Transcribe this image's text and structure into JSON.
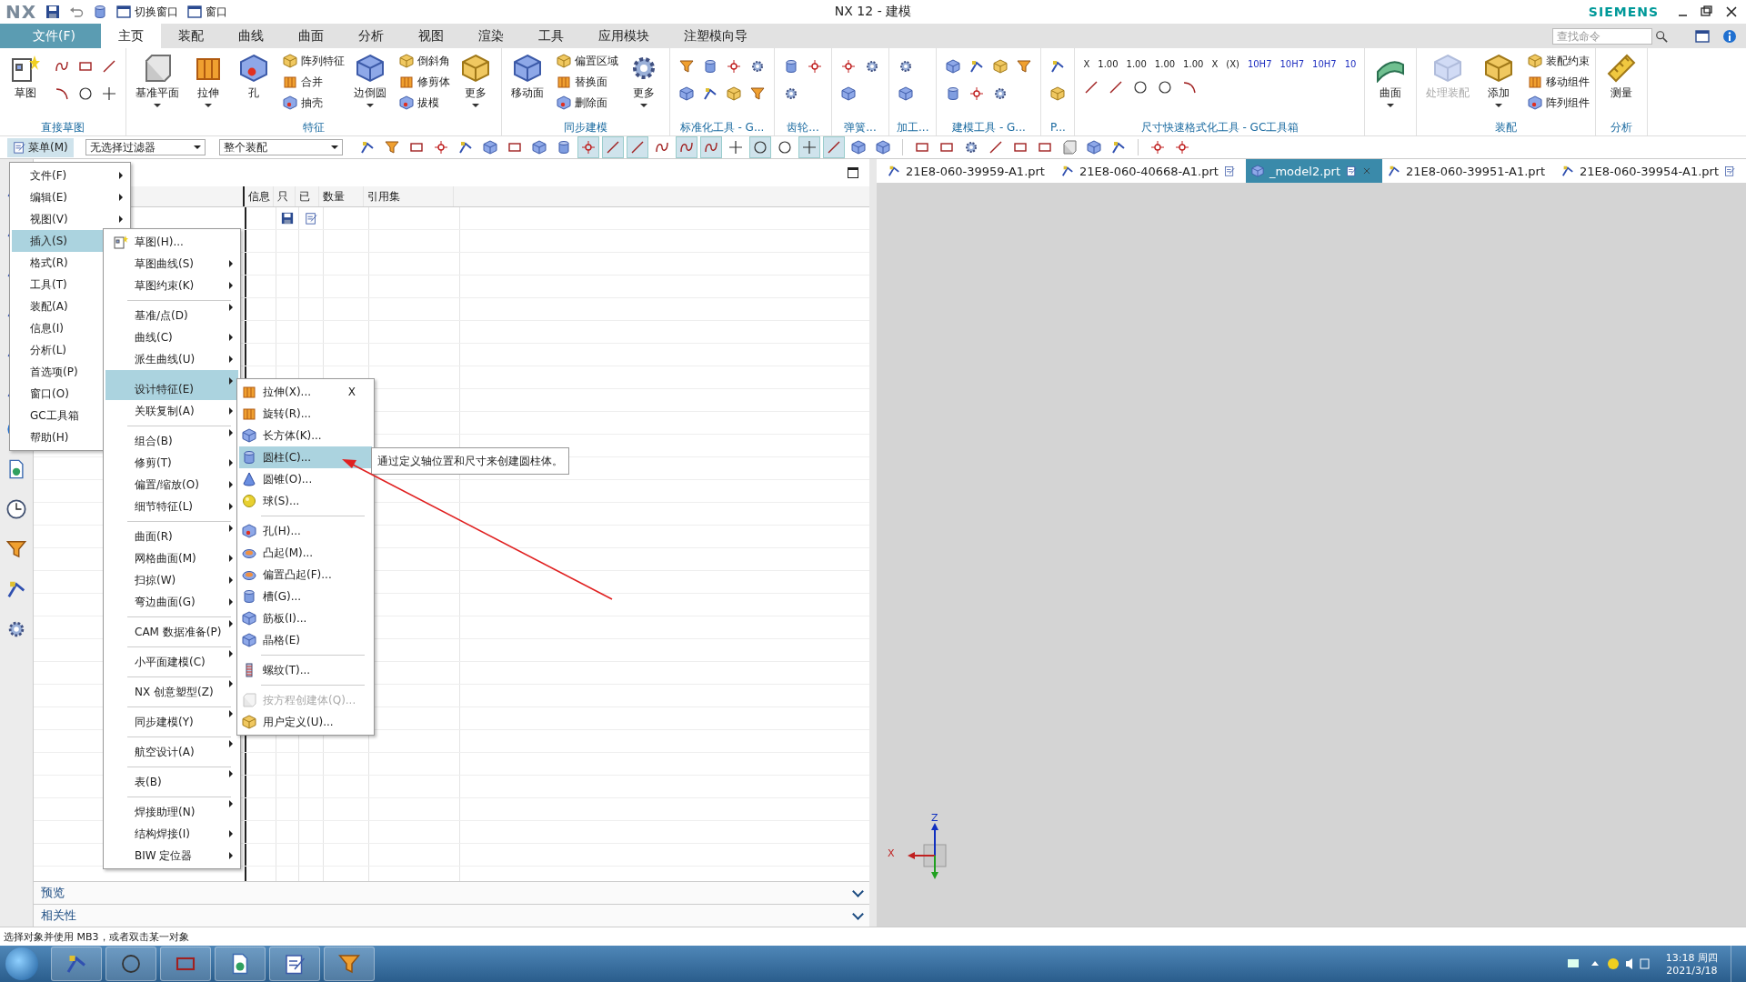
{
  "title_bar": {
    "app_logo": "NX",
    "quick_access": [
      {
        "label": "切换窗口"
      },
      {
        "label": "窗口"
      }
    ],
    "title": "NX 12 - 建模",
    "brand": "SIEMENS"
  },
  "ribbon_tabs": [
    {
      "label": "文件(F)",
      "kind": "file",
      "selected": false
    },
    {
      "label": "主页",
      "kind": "tab",
      "selected": true
    },
    {
      "label": "装配",
      "kind": "tab",
      "selected": false
    },
    {
      "label": "曲线",
      "kind": "tab",
      "selected": false
    },
    {
      "label": "曲面",
      "kind": "tab",
      "selected": false
    },
    {
      "label": "分析",
      "kind": "tab",
      "selected": false
    },
    {
      "label": "视图",
      "kind": "tab",
      "selected": false
    },
    {
      "label": "渲染",
      "kind": "tab",
      "selected": false
    },
    {
      "label": "工具",
      "kind": "tab",
      "selected": false
    },
    {
      "label": "应用模块",
      "kind": "tab",
      "selected": false
    },
    {
      "label": "注塑模向导",
      "kind": "tab",
      "selected": false
    }
  ],
  "search": {
    "placeholder": "查找命令"
  },
  "ribbon_groups": [
    {
      "label": "直接草图",
      "items": [
        {
          "kind": "large",
          "label": "草图",
          "dropdown": false,
          "disabled": false
        },
        {
          "kind": "grid"
        }
      ]
    },
    {
      "label": "特征",
      "items": [
        {
          "kind": "large",
          "label": "基准平面",
          "dropdown": true,
          "disabled": false
        },
        {
          "kind": "large",
          "label": "拉伸",
          "dropdown": true,
          "disabled": false
        },
        {
          "kind": "large",
          "label": "孔",
          "dropdown": false,
          "disabled": false
        },
        {
          "kind": "stack",
          "entries": [
            "阵列特征",
            "合并",
            "抽壳"
          ]
        },
        {
          "kind": "large",
          "label": "边倒圆",
          "dropdown": true,
          "disabled": false
        },
        {
          "kind": "stack",
          "entries": [
            "倒斜角",
            "修剪体",
            "拔模"
          ]
        },
        {
          "kind": "large",
          "label": "更多",
          "dropdown": true,
          "disabled": false
        }
      ]
    },
    {
      "label": "同步建模",
      "items": [
        {
          "kind": "large",
          "label": "移动面",
          "dropdown": false,
          "disabled": false
        },
        {
          "kind": "stack",
          "entries": [
            "偏置区域",
            "替换面",
            "删除面"
          ]
        },
        {
          "kind": "large",
          "label": "更多",
          "dropdown": true,
          "disabled": false
        }
      ]
    },
    {
      "label": "标准化工具 - G...",
      "items": [
        {
          "kind": "grid"
        }
      ]
    },
    {
      "label": "齿轮...",
      "items": [
        {
          "kind": "grid"
        }
      ]
    },
    {
      "label": "弹簧...",
      "items": [
        {
          "kind": "grid"
        }
      ]
    },
    {
      "label": "加工...",
      "items": [
        {
          "kind": "grid"
        }
      ]
    },
    {
      "label": "建模工具 - G...",
      "items": [
        {
          "kind": "grid"
        }
      ]
    },
    {
      "label": "P...",
      "items": [
        {
          "kind": "grid"
        }
      ]
    },
    {
      "label": "尺寸快速格式化工具 - GC工具箱",
      "items": [
        {
          "kind": "format",
          "entries": [
            "X",
            "1.00",
            "1.00",
            "1.00",
            "1.00",
            "X",
            "(X)",
            "10H7",
            "10H7",
            "10H7",
            "10"
          ]
        }
      ]
    },
    {
      "items": [
        {
          "kind": "large",
          "label": "曲面",
          "dropdown": true,
          "disabled": false
        }
      ]
    },
    {
      "label": "装配",
      "items": [
        {
          "kind": "large",
          "label": "处理装配",
          "dropdown": false,
          "disabled": true
        },
        {
          "kind": "large",
          "label": "添加",
          "dropdown": true,
          "disabled": false
        },
        {
          "kind": "stack",
          "entries": [
            "装配约束",
            "移动组件",
            "阵列组件"
          ]
        }
      ]
    },
    {
      "label": "分析",
      "items": [
        {
          "kind": "large",
          "label": "测量",
          "dropdown": false,
          "disabled": false
        }
      ]
    }
  ],
  "toolbar": {
    "menu_button": "菜单(M)",
    "filters": [
      {
        "value": "无选择过滤器"
      },
      {
        "value": "整个装配"
      }
    ],
    "snap_buttons": [
      {
        "on": true
      },
      {
        "on": true
      },
      {
        "on": true
      },
      {
        "on": false
      },
      {
        "on": true
      },
      {
        "on": true
      },
      {
        "on": false
      },
      {
        "on": true
      },
      {
        "on": false
      },
      {
        "on": true
      },
      {
        "on": true
      },
      {
        "on": false
      },
      {
        "on": false
      }
    ]
  },
  "navigator": {
    "columns": [
      "信息",
      "只",
      "已",
      "数量",
      "引用集"
    ],
    "sections": [
      {
        "label": "预览",
        "expanded": false
      },
      {
        "label": "相关性",
        "expanded": false
      }
    ]
  },
  "main_menu": [
    {
      "label": "文件(F)",
      "selected": false
    },
    {
      "label": "编辑(E)",
      "selected": false
    },
    {
      "label": "视图(V)",
      "selected": false
    },
    {
      "label": "插入(S)",
      "selected": true
    },
    {
      "label": "格式(R)",
      "selected": false
    },
    {
      "label": "工具(T)",
      "selected": false
    },
    {
      "label": "装配(A)",
      "selected": false
    },
    {
      "label": "信息(I)",
      "selected": false
    },
    {
      "label": "分析(L)",
      "selected": false
    },
    {
      "label": "首选项(P)",
      "selected": false
    },
    {
      "label": "窗口(O)",
      "selected": false
    },
    {
      "label": "GC工具箱",
      "selected": false
    },
    {
      "label": "帮助(H)",
      "selected": false
    }
  ],
  "insert_menu": [
    {
      "label": "草图(H)...",
      "submenu": false,
      "separator_before": false,
      "selected": false
    },
    {
      "label": "草图曲线(S)",
      "submenu": true,
      "separator_before": false,
      "selected": false
    },
    {
      "label": "草图约束(K)",
      "submenu": true,
      "separator_before": false,
      "selected": false
    },
    {
      "label": "基准/点(D)",
      "submenu": true,
      "separator_before": true,
      "selected": false
    },
    {
      "label": "曲线(C)",
      "submenu": true,
      "separator_before": false,
      "selected": false
    },
    {
      "label": "派生曲线(U)",
      "submenu": true,
      "separator_before": false,
      "selected": false
    },
    {
      "label": "设计特征(E)",
      "submenu": true,
      "separator_before": true,
      "selected": true
    },
    {
      "label": "关联复制(A)",
      "submenu": true,
      "separator_before": false,
      "selected": false
    },
    {
      "label": "组合(B)",
      "submenu": true,
      "separator_before": true,
      "selected": false
    },
    {
      "label": "修剪(T)",
      "submenu": true,
      "separator_before": false,
      "selected": false
    },
    {
      "label": "偏置/缩放(O)",
      "submenu": true,
      "separator_before": false,
      "selected": false
    },
    {
      "label": "细节特征(L)",
      "submenu": true,
      "separator_before": false,
      "selected": false
    },
    {
      "label": "曲面(R)",
      "submenu": true,
      "separator_before": true,
      "selected": false
    },
    {
      "label": "网格曲面(M)",
      "submenu": true,
      "separator_before": false,
      "selected": false
    },
    {
      "label": "扫掠(W)",
      "submenu": true,
      "separator_before": false,
      "selected": false
    },
    {
      "label": "弯边曲面(G)",
      "submenu": true,
      "separator_before": false,
      "selected": false
    },
    {
      "label": "CAM 数据准备(P)",
      "submenu": true,
      "separator_before": true,
      "selected": false
    },
    {
      "label": "小平面建模(C)",
      "submenu": true,
      "separator_before": true,
      "selected": false
    },
    {
      "label": "NX 创意塑型(Z)",
      "submenu": true,
      "separator_before": true,
      "selected": false
    },
    {
      "label": "同步建模(Y)",
      "submenu": true,
      "separator_before": true,
      "selected": false
    },
    {
      "label": "航空设计(A)",
      "submenu": true,
      "separator_before": true,
      "selected": false
    },
    {
      "label": "表(B)",
      "submenu": true,
      "separator_before": true,
      "selected": false
    },
    {
      "label": "焊接助理(N)",
      "submenu": true,
      "separator_before": true,
      "selected": false
    },
    {
      "label": "结构焊接(I)",
      "submenu": true,
      "separator_before": false,
      "selected": false
    },
    {
      "label": "BIW 定位器",
      "submenu": true,
      "separator_before": false,
      "selected": false
    }
  ],
  "feature_menu": [
    {
      "label": "拉伸(X)...",
      "shortcut": "X",
      "separator_before": false,
      "selected": false,
      "disabled": false
    },
    {
      "label": "旋转(R)...",
      "separator_before": false,
      "selected": false,
      "disabled": false
    },
    {
      "label": "长方体(K)...",
      "separator_before": false,
      "selected": false,
      "disabled": false
    },
    {
      "label": "圆柱(C)...",
      "separator_before": false,
      "selected": true,
      "disabled": false
    },
    {
      "label": "圆锥(O)...",
      "separator_before": false,
      "selected": false,
      "disabled": false
    },
    {
      "label": "球(S)...",
      "separator_before": false,
      "selected": false,
      "disabled": false
    },
    {
      "label": "孔(H)...",
      "separator_before": true,
      "selected": false,
      "disabled": false
    },
    {
      "label": "凸起(M)...",
      "separator_before": false,
      "selected": false,
      "disabled": false
    },
    {
      "label": "偏置凸起(F)...",
      "separator_before": false,
      "selected": false,
      "disabled": false
    },
    {
      "label": "槽(G)...",
      "separator_before": false,
      "selected": false,
      "disabled": false
    },
    {
      "label": "筋板(I)...",
      "separator_before": false,
      "selected": false,
      "disabled": false
    },
    {
      "label": "晶格(E)",
      "separator_before": false,
      "selected": false,
      "disabled": false
    },
    {
      "label": "螺纹(T)...",
      "separator_before": true,
      "selected": false,
      "disabled": false
    },
    {
      "label": "按方程创建体(Q)...",
      "separator_before": true,
      "selected": false,
      "disabled": true
    },
    {
      "label": "用户定义(U)...",
      "separator_before": false,
      "selected": false,
      "disabled": false
    }
  ],
  "tooltip": "通过定义轴位置和尺寸来创建圆柱体。",
  "doc_tabs": [
    {
      "label": "21E8-060-39959-A1.prt",
      "selected": false,
      "modified": false
    },
    {
      "label": "21E8-060-40668-A1.prt",
      "selected": false,
      "modified": true
    },
    {
      "label": "_model2.prt",
      "selected": true,
      "modified": true
    },
    {
      "label": "21E8-060-39951-A1.prt",
      "selected": false,
      "modified": false
    },
    {
      "label": "21E8-060-39954-A1.prt",
      "selected": false,
      "modified": true
    }
  ],
  "triad": {
    "labels": [
      "Z",
      "X"
    ]
  },
  "status_bar": "选择对象并使用 MB3，或者双击某一对象",
  "taskbar": {
    "time": "13:18 周四",
    "date": "2021/3/18"
  }
}
